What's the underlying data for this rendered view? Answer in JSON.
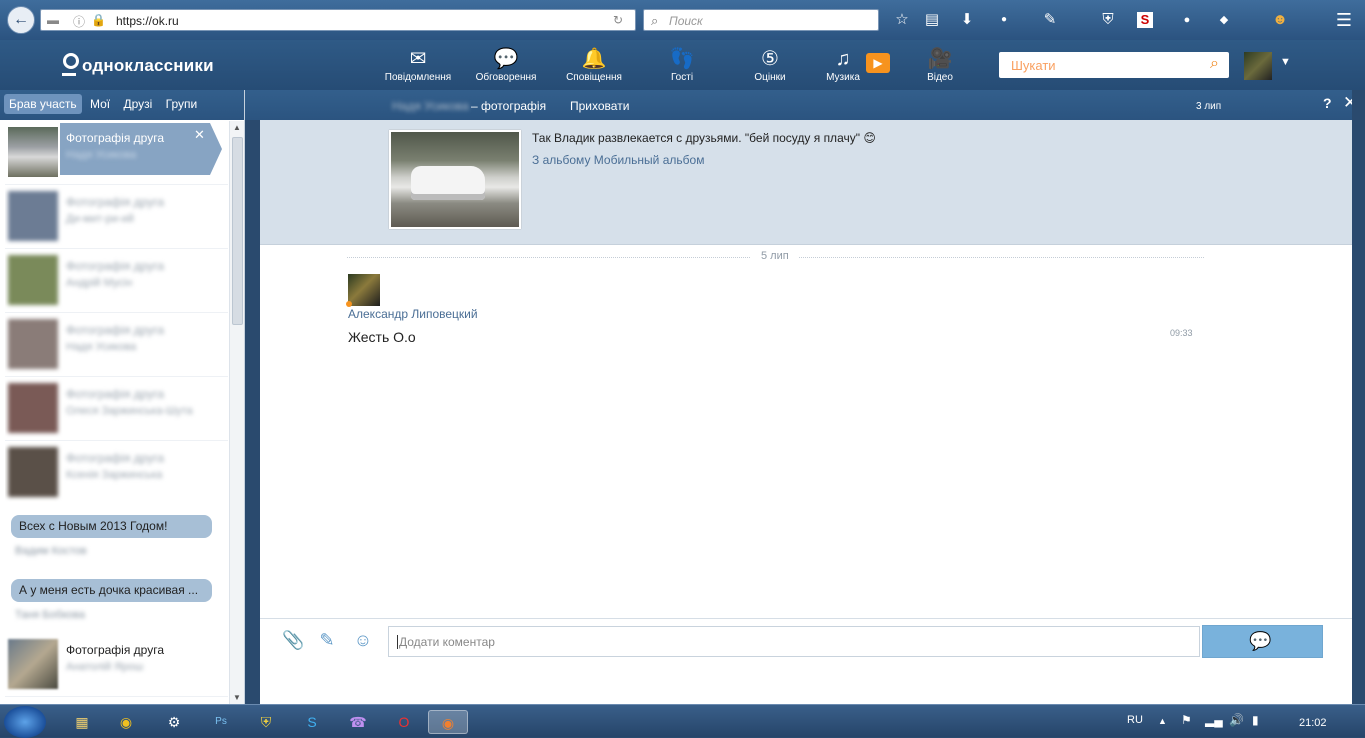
{
  "browser": {
    "url": "https://ok.ru",
    "search_placeholder": "Поиск",
    "back_glyph": "←",
    "toolbar_icons": [
      "star-icon",
      "clipboard-icon",
      "download-icon",
      "adblock-icon",
      "pen-icon",
      "shield-icon",
      "s-icon",
      "extension-icon",
      "extension-icon",
      "monkey-icon",
      "menu-icon"
    ]
  },
  "header": {
    "logo": "одноклассники",
    "nav": [
      {
        "label": "Повідомлення",
        "icon": "✉"
      },
      {
        "label": "Обговорення",
        "icon": "💬"
      },
      {
        "label": "Сповіщення",
        "icon": "🔔"
      },
      {
        "label": "Гості",
        "icon": "👣"
      },
      {
        "label": "Оцінки",
        "icon": "⑤"
      },
      {
        "label": "Музика",
        "icon": "♫"
      },
      {
        "label": "Відео",
        "icon": "🎥"
      }
    ],
    "search_placeholder": "Шукати",
    "caret": "▼"
  },
  "left": {
    "tabs": [
      "Брав участь",
      "Мої",
      "Друзі",
      "Групи"
    ],
    "selected_item": {
      "title": "Фотографія друга",
      "subtitle": "Надя Усикова"
    },
    "blurred_items": [
      {
        "title": "Фотографія друга",
        "subtitle": "Ди-мит-ри-ий"
      },
      {
        "title": "Фотографія друга",
        "subtitle": "Андрій Мусін"
      },
      {
        "title": "Фотографія друга",
        "subtitle": "Надя Усикова"
      },
      {
        "title": "Фотографія друга",
        "subtitle": "Олеся Заржинська-Шута"
      },
      {
        "title": "Фотографія друга",
        "subtitle": "Ксенія Заржинська"
      }
    ],
    "bubbles": [
      {
        "text": "Всех с Новым 2013 Годом!",
        "who": "Вадим Костов"
      },
      {
        "text": "А у меня есть дочка красивая ...",
        "who": "Таня Бобкова"
      }
    ],
    "photo_item": {
      "title": "Фотографія друга",
      "subtitle": "Анатолій Ярош"
    }
  },
  "right": {
    "owner": "Надя Усикова",
    "title": "– фотографія",
    "hide": "Приховати",
    "date": "3 лип",
    "help": "?",
    "close": "✕",
    "topic_text": "Так Владик развлекается с друзьями. \"бей посуду я плачу\" 😊",
    "album_prefix": "З альбому",
    "album_name": "Мобильный альбом",
    "date_sep": "5 лип",
    "message": {
      "author": "Александр Липовецкий",
      "text": "Жесть О.о",
      "time": "09:33"
    },
    "composer_placeholder": "Додати коментар"
  },
  "taskbar": {
    "lang": "RU",
    "time": "21:02"
  }
}
